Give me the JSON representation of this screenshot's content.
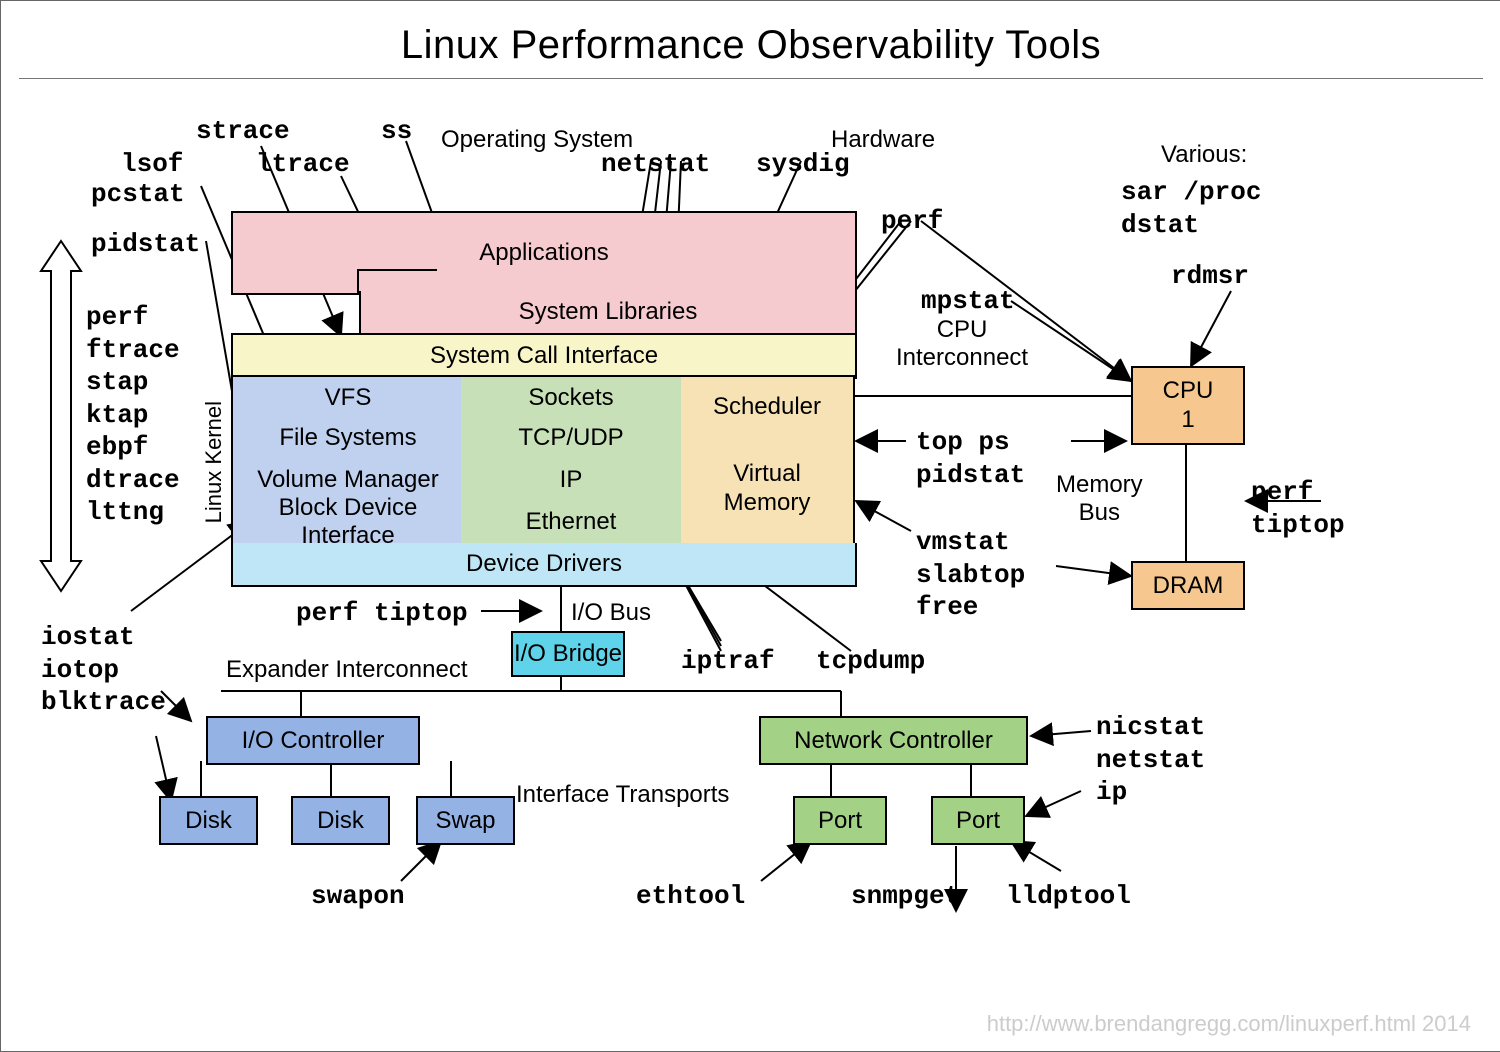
{
  "title": "Linux Performance Observability Tools",
  "headers": {
    "os": "Operating System",
    "hw": "Hardware",
    "various": "Various:",
    "cpuic": "CPU\nInterconnect",
    "membus": "Memory\nBus",
    "iobus": "I/O Bus",
    "exp": "Expander Interconnect",
    "itrans": "Interface Transports",
    "kernel": "Linux Kernel"
  },
  "layers": {
    "apps": "Applications",
    "syslib": "System Libraries",
    "sci": "System Call Interface",
    "vfs": "VFS",
    "fs": "File Systems",
    "vm": "Volume Manager",
    "bdi": "Block Device Interface",
    "sock": "Sockets",
    "tcp": "TCP/UDP",
    "ip": "IP",
    "eth": "Ethernet",
    "sched": "Scheduler",
    "vmem": "Virtual\nMemory",
    "dd": "Device Drivers",
    "iobridge": "I/O Bridge",
    "ioctl": "I/O Controller",
    "netctl": "Network Controller",
    "disk": "Disk",
    "swap": "Swap",
    "port": "Port",
    "cpu": "CPU\n1",
    "dram": "DRAM"
  },
  "tools": {
    "strace": "strace",
    "ss": "ss",
    "lsof": "lsof",
    "pcstat": "pcstat",
    "ltrace": "ltrace",
    "pidstat": "pidstat",
    "leftstack": "perf\nftrace\nstap\nktap\nebpf\ndtrace\nlttng",
    "netstat": "netstat",
    "sysdig": "sysdig",
    "perf": "perf",
    "mpstat": "mpstat",
    "rdmsr": "rdmsr",
    "various": "sar /proc\ndstat",
    "topps": "top ps\npidstat",
    "perf2": "perf\ntiptop",
    "vmstat": "vmstat\nslabtop\nfree",
    "iostat": "iostat\niotop\nblktrace",
    "perftiptop": "perf tiptop",
    "iptraf": "iptraf",
    "tcpdump": "tcpdump",
    "swapon": "swapon",
    "ethtool": "ethtool",
    "snmpget": "snmpget",
    "lldptool": "lldptool",
    "nicstat": "nicstat\nnetstat\nip"
  },
  "footer": "http://www.brendangregg.com/linuxperf.html 2014"
}
